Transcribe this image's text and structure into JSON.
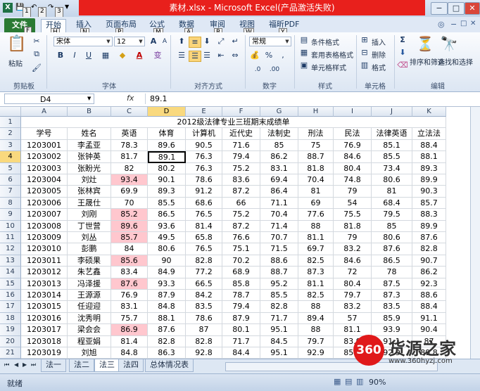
{
  "window": {
    "title": "素材.xlsx - Microsoft Excel(产品激活失败)",
    "min": "−",
    "max": "□",
    "close": "✕"
  },
  "qat": {
    "keytips": [
      "1",
      "2",
      "3"
    ]
  },
  "tabs": [
    {
      "label": "文件",
      "key": "F"
    },
    {
      "label": "开始",
      "key": "H"
    },
    {
      "label": "插入",
      "key": "N"
    },
    {
      "label": "页面布局",
      "key": "P"
    },
    {
      "label": "公式",
      "key": "M"
    },
    {
      "label": "数据",
      "key": "A"
    },
    {
      "label": "审阅",
      "key": "R"
    },
    {
      "label": "视图",
      "key": "W"
    },
    {
      "label": "福昕PDF",
      "key": "Y"
    }
  ],
  "ribbon": {
    "paste": "粘贴",
    "font_name": "宋体",
    "font_size": "12",
    "number_format": "常规",
    "cond_format": "条件格式",
    "table_format": "套用表格格式",
    "cell_style": "单元格样式",
    "insert": "插入",
    "delete": "删除",
    "format": "格式",
    "sort_filter": "排序和筛选",
    "find_select": "查找和选择",
    "groups": {
      "clipboard": "剪贴板",
      "font": "字体",
      "align": "对齐方式",
      "number": "数字",
      "styles": "样式",
      "cells": "单元格",
      "edit": "编辑"
    }
  },
  "formula_bar": {
    "name_box": "D4",
    "fx": "fx",
    "content": "89.1"
  },
  "columns": [
    "A",
    "B",
    "C",
    "D",
    "E",
    "F",
    "G",
    "H",
    "I",
    "J",
    "K"
  ],
  "sheet": {
    "title": "2012级法律专业三班期末成绩单",
    "headers": [
      "学号",
      "姓名",
      "英语",
      "体育",
      "计算机",
      "近代史",
      "法制史",
      "刑法",
      "民法",
      "法律英语",
      "立法法"
    ],
    "rows": [
      [
        "1203001",
        "李孟亚",
        "78.3",
        "89.6",
        "90.5",
        "71.6",
        "85",
        "75",
        "76.9",
        "85.1",
        "88.4"
      ],
      [
        "1203002",
        "张钟英",
        "81.7",
        "89.1",
        "76.3",
        "79.4",
        "86.2",
        "88.7",
        "84.6",
        "85.5",
        "88.1"
      ],
      [
        "1203003",
        "张盼光",
        "82",
        "80.2",
        "76.3",
        "75.2",
        "83.1",
        "81.8",
        "80.4",
        "73.4",
        "89.3"
      ],
      [
        "1203004",
        "刘灶",
        "93.4",
        "90.1",
        "78.6",
        "83.6",
        "69.4",
        "70.4",
        "74.8",
        "80.6",
        "89.9"
      ],
      [
        "1203005",
        "张林宾",
        "69.9",
        "89.3",
        "91.2",
        "87.2",
        "86.4",
        "81",
        "79",
        "81",
        "90.3"
      ],
      [
        "1203006",
        "王晟仕",
        "70",
        "85.5",
        "68.6",
        "66",
        "71.1",
        "69",
        "54",
        "68.4",
        "85.7"
      ],
      [
        "1203007",
        "刘刚",
        "85.2",
        "86.5",
        "76.5",
        "75.2",
        "70.4",
        "77.6",
        "75.5",
        "79.5",
        "88.3"
      ],
      [
        "1203008",
        "丁世营",
        "89.6",
        "93.6",
        "81.4",
        "87.2",
        "71.4",
        "88",
        "81.8",
        "85",
        "89.9"
      ],
      [
        "1203009",
        "刘丛",
        "85.7",
        "49.5",
        "65.8",
        "76.6",
        "70.7",
        "81.1",
        "79",
        "80.6",
        "87.6"
      ],
      [
        "1203010",
        "彭鹏",
        "84",
        "80.6",
        "76.5",
        "75.1",
        "71.5",
        "69.7",
        "83.2",
        "87.6",
        "82.8"
      ],
      [
        "1203011",
        "李硕果",
        "85.6",
        "90",
        "82.8",
        "70.2",
        "88.6",
        "82.5",
        "84.6",
        "86.5",
        "90.7"
      ],
      [
        "1203012",
        "朱艺鑫",
        "83.4",
        "84.9",
        "77.2",
        "68.9",
        "88.7",
        "87.3",
        "72",
        "78",
        "86.2"
      ],
      [
        "1203013",
        "冯泽援",
        "87.6",
        "93.3",
        "66.5",
        "85.8",
        "95.2",
        "81.1",
        "80.4",
        "87.5",
        "92.3"
      ],
      [
        "1203014",
        "王源源",
        "76.9",
        "87.9",
        "84.2",
        "78.7",
        "85.5",
        "82.5",
        "79.7",
        "87.3",
        "88.6"
      ],
      [
        "1203015",
        "任迎迎",
        "83.1",
        "84.8",
        "83.5",
        "79.4",
        "82.8",
        "88",
        "83.2",
        "83.5",
        "88.4"
      ],
      [
        "1203016",
        "沈秀明",
        "75.7",
        "88.1",
        "78.6",
        "87.9",
        "71.7",
        "89.4",
        "57",
        "85.9",
        "91.1"
      ],
      [
        "1203017",
        "梁会会",
        "86.9",
        "87.6",
        "87",
        "80.1",
        "95.1",
        "88",
        "81.1",
        "93.9",
        "90.4"
      ],
      [
        "1203018",
        "程亚娟",
        "81.4",
        "82.8",
        "82.8",
        "71.7",
        "84.5",
        "79.7",
        "83.9",
        "91.1",
        "87"
      ],
      [
        "1203019",
        "刘旭",
        "84.8",
        "86.3",
        "92.8",
        "84.4",
        "95.1",
        "92.9",
        "85.3",
        "92.9",
        "89.8"
      ],
      [
        "1203020",
        "张晓平",
        "82.8",
        "84.8",
        "79.3",
        "72.4",
        "81.4",
        "79",
        "81.8",
        "93.2",
        "88.9"
      ],
      [
        "1203021",
        "王浩",
        "77.2",
        "89.5",
        "86.3",
        "73.1",
        "82.9",
        "76.9",
        "79",
        "",
        ""
      ],
      [
        "1203022",
        "王颖",
        "77.2",
        "84.8",
        "85.6",
        "80.1",
        "72.5",
        "88.7",
        "81.8",
        "",
        ""
      ],
      [
        "1203023",
        "路俊俊",
        "91.4",
        "84",
        "78.6",
        "83.8",
        "72.1",
        "86.6",
        "79",
        "",
        ""
      ]
    ]
  },
  "sheets": [
    "法一",
    "法二",
    "法三",
    "法四",
    "总体情况表"
  ],
  "status": {
    "ready": "就绪",
    "zoom": "90%"
  },
  "watermark": {
    "badge": "360",
    "brand": "货源之家",
    "url": "www.360hyzj.com"
  },
  "colors": {
    "file_tab": "#2a7a33",
    "title_bar": "#e8201c",
    "highlight": "#ffc7ce",
    "selected_header": "#f9d97e"
  }
}
